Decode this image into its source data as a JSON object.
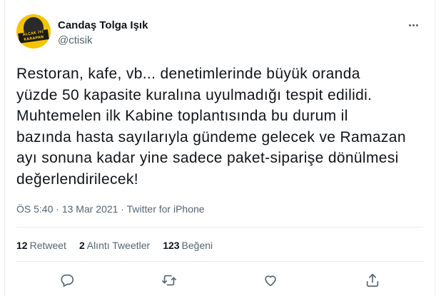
{
  "author": {
    "display_name": "Candaş Tolga Işık",
    "handle": "@ctisik",
    "avatar_text": "ALÇAK İYİ KARAPAN"
  },
  "tweet": {
    "lines": [
      "Restoran, kafe, vb... denetimlerinde büyük oranda",
      "yüzde 50 kapasite kuralına uyulmadığı tespit edilidi.",
      "Muhtemelen ilk Kabine toplantısında bu durum il",
      "bazında hasta sayılarıyla gündeme gelecek ve Ramazan",
      "ayı sonuna kadar yine sadece paket-siparişe dönülmesi",
      "değerlendirilecek!"
    ],
    "time": "ÖS 5:40",
    "date": "13 Mar 2021",
    "separator": "·",
    "source": "Twitter for iPhone"
  },
  "stats": {
    "retweets_count": "12",
    "retweets_label": "Retweet",
    "quotes_count": "2",
    "quotes_label": "Alıntı Tweetler",
    "likes_count": "123",
    "likes_label": "Beğeni"
  },
  "actions": {
    "reply_icon": "reply-icon",
    "retweet_icon": "retweet-icon",
    "like_icon": "heart-icon",
    "share_icon": "share-icon"
  },
  "colors": {
    "text_primary": "#0f1419",
    "text_secondary": "#536471",
    "divider": "#e6ecf0",
    "avatar_bg": "#f5c400"
  }
}
